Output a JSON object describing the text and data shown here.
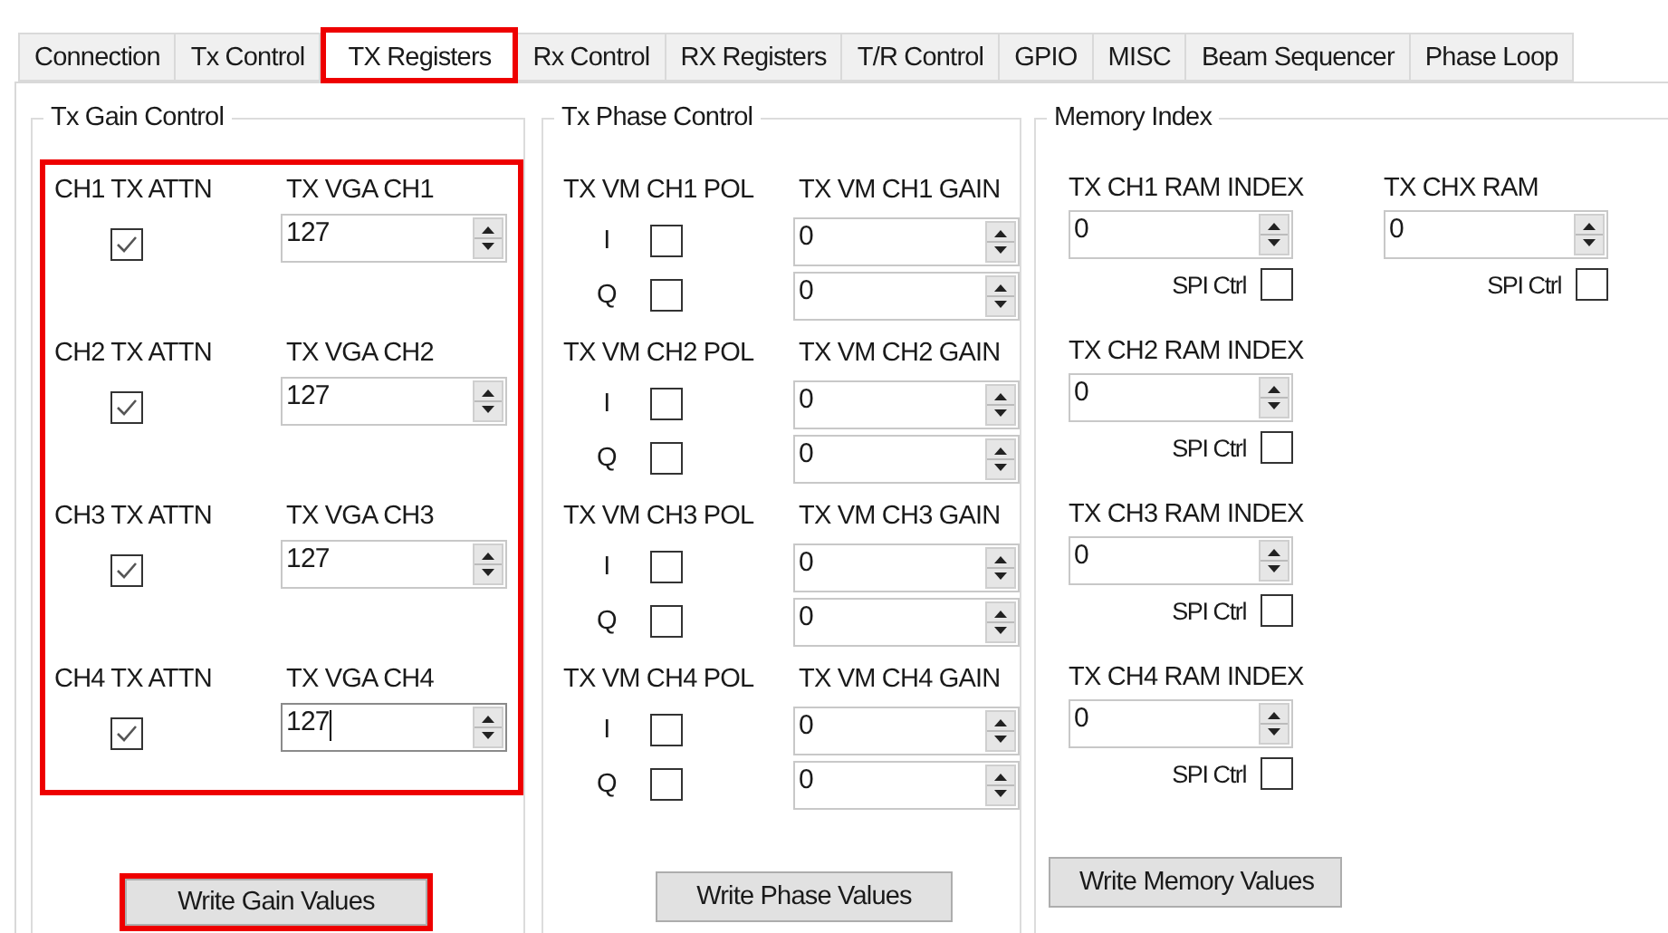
{
  "tabs": [
    {
      "label": "Connection",
      "selected": false,
      "highlighted": false
    },
    {
      "label": "Tx Control",
      "selected": false,
      "highlighted": false
    },
    {
      "label": "TX Registers",
      "selected": true,
      "highlighted": true
    },
    {
      "label": "Rx Control",
      "selected": false,
      "highlighted": false
    },
    {
      "label": "RX Registers",
      "selected": false,
      "highlighted": false
    },
    {
      "label": "T/R Control",
      "selected": false,
      "highlighted": false
    },
    {
      "label": "GPIO",
      "selected": false,
      "highlighted": false
    },
    {
      "label": "MISC",
      "selected": false,
      "highlighted": false
    },
    {
      "label": "Beam Sequencer",
      "selected": false,
      "highlighted": false
    },
    {
      "label": "Phase Loop",
      "selected": false,
      "highlighted": false
    }
  ],
  "gain_control": {
    "title": "Tx Gain Control",
    "highlighted": true,
    "channels": [
      {
        "attn_label": "CH1 TX ATTN",
        "attn_checked": true,
        "vga_label": "TX VGA CH1",
        "vga_value": "127",
        "focused": false
      },
      {
        "attn_label": "CH2 TX ATTN",
        "attn_checked": true,
        "vga_label": "TX VGA CH2",
        "vga_value": "127",
        "focused": false
      },
      {
        "attn_label": "CH3 TX ATTN",
        "attn_checked": true,
        "vga_label": "TX VGA CH3",
        "vga_value": "127",
        "focused": false
      },
      {
        "attn_label": "CH4 TX ATTN",
        "attn_checked": true,
        "vga_label": "TX VGA CH4",
        "vga_value": "127",
        "focused": true
      }
    ],
    "button": {
      "label": "Write Gain Values",
      "highlighted": true
    }
  },
  "phase_control": {
    "title": "Tx Phase Control",
    "channels": [
      {
        "pol_label": "TX VM CH1 POL",
        "gain_label": "TX VM CH1 GAIN",
        "rows": [
          {
            "label": "I",
            "checked": false,
            "value": "0"
          },
          {
            "label": "Q",
            "checked": false,
            "value": "0"
          }
        ]
      },
      {
        "pol_label": "TX VM CH2 POL",
        "gain_label": "TX VM CH2 GAIN",
        "rows": [
          {
            "label": "I",
            "checked": false,
            "value": "0"
          },
          {
            "label": "Q",
            "checked": false,
            "value": "0"
          }
        ]
      },
      {
        "pol_label": "TX VM CH3 POL",
        "gain_label": "TX VM CH3 GAIN",
        "rows": [
          {
            "label": "I",
            "checked": false,
            "value": "0"
          },
          {
            "label": "Q",
            "checked": false,
            "value": "0"
          }
        ]
      },
      {
        "pol_label": "TX VM CH4 POL",
        "gain_label": "TX VM CH4 GAIN",
        "rows": [
          {
            "label": "I",
            "checked": false,
            "value": "0"
          },
          {
            "label": "Q",
            "checked": false,
            "value": "0"
          }
        ]
      }
    ],
    "button": {
      "label": "Write Phase Values",
      "highlighted": false
    }
  },
  "memory_index": {
    "title": "Memory Index",
    "columns": [
      {
        "entries": [
          {
            "label": "TX CH1 RAM INDEX",
            "value": "0",
            "spi_label": "SPI Ctrl",
            "spi_checked": false
          },
          {
            "label": "TX CH2 RAM INDEX",
            "value": "0",
            "spi_label": "SPI Ctrl",
            "spi_checked": false
          },
          {
            "label": "TX CH3 RAM INDEX",
            "value": "0",
            "spi_label": "SPI Ctrl",
            "spi_checked": false
          },
          {
            "label": "TX CH4 RAM INDEX",
            "value": "0",
            "spi_label": "SPI Ctrl",
            "spi_checked": false
          }
        ]
      },
      {
        "entries": [
          {
            "label": "TX CHX RAM",
            "value": "0",
            "spi_label": "SPI Ctrl",
            "spi_checked": false
          }
        ]
      }
    ],
    "button": {
      "label": "Write Memory Values",
      "highlighted": false
    }
  }
}
